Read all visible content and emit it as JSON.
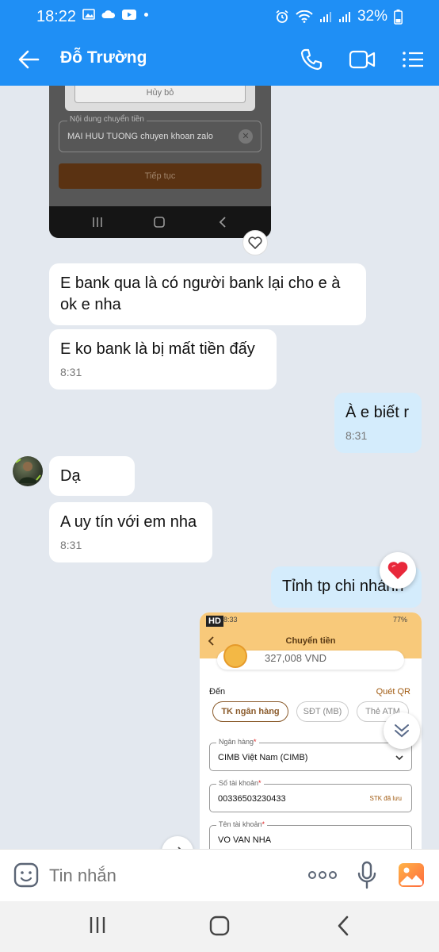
{
  "status": {
    "time": "18:22",
    "battery": "32%"
  },
  "header": {
    "title": "Đỗ Trường"
  },
  "shot1": {
    "cancel": "Hủy bỏ",
    "field_label": "Nội dung chuyển tiền",
    "field_value": "MAI HUU TUONG chuyen khoan zalo",
    "button": "Tiếp tục"
  },
  "messages": [
    {
      "text": "E bank qua là có người bank lại cho e à ok e nha"
    },
    {
      "text": "E ko bank là bị mất tiền đấy",
      "time": "8:31"
    },
    {
      "text": "À e biết r",
      "time": "8:31"
    },
    {
      "text": "Dạ"
    },
    {
      "text": "A uy tín với em nha",
      "time": "8:31"
    },
    {
      "text": "Tỉnh tp chi nhánh"
    }
  ],
  "shot2": {
    "hd": "HD",
    "time": "8:33",
    "battery": "77%",
    "title": "Chuyển tiền",
    "amount": "327,008 VND",
    "to_label": "Đến",
    "qr": "Quét QR",
    "tabs": [
      "TK ngân hàng",
      "SĐT (MB)",
      "Thẻ ATM"
    ],
    "bank_label": "Ngân hàng",
    "bank_value": "CIMB Việt Nam (CIMB)",
    "account_label": "Số tài khoản",
    "account_value": "00336503230433",
    "saved": "STK đã lưu",
    "name_label": "Tên tài khoản",
    "name_value": "VO VAN NHA"
  },
  "input": {
    "placeholder": "Tin nhắn"
  }
}
